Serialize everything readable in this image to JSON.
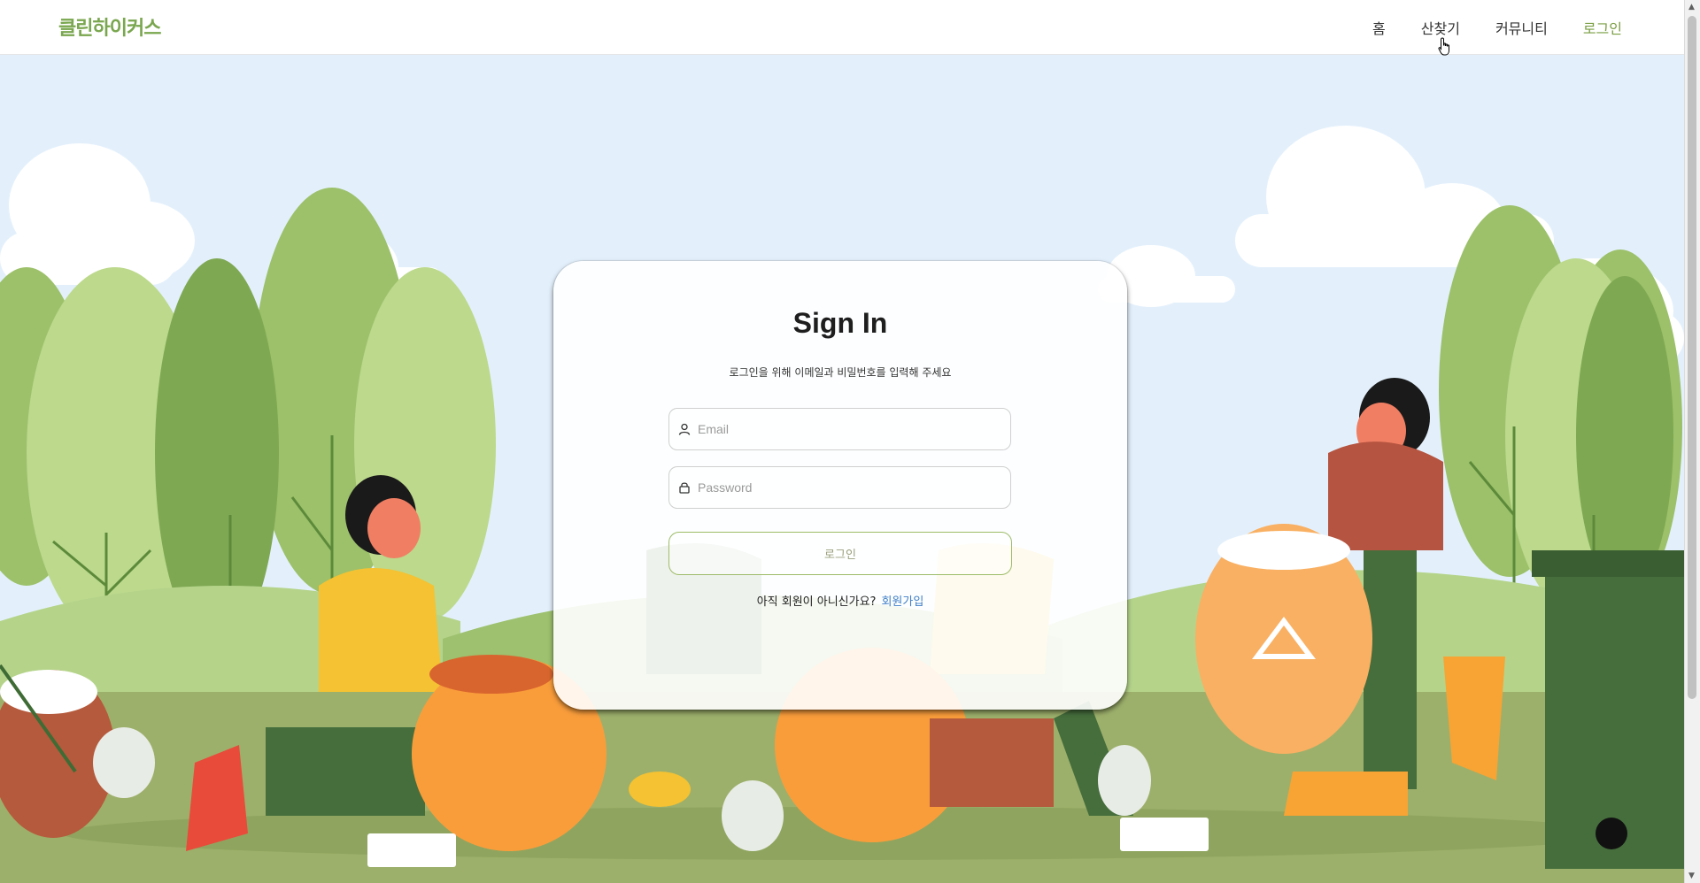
{
  "header": {
    "logo": "클린하이커스",
    "nav": [
      "홈",
      "산찾기",
      "커뮤니티",
      "로그인"
    ]
  },
  "signin": {
    "title": "Sign In",
    "subtitle": "로그인을 위해 이메일과 비밀번호를 입력해 주세요",
    "email_placeholder": "Email",
    "password_placeholder": "Password",
    "login_button": "로그인",
    "signup_prompt": "아직 회원이 아니신가요?",
    "signup_link": "회원가입"
  },
  "colors": {
    "accent": "#79a64e",
    "link": "#3f7fc7",
    "sky": "#e3f0fc"
  }
}
